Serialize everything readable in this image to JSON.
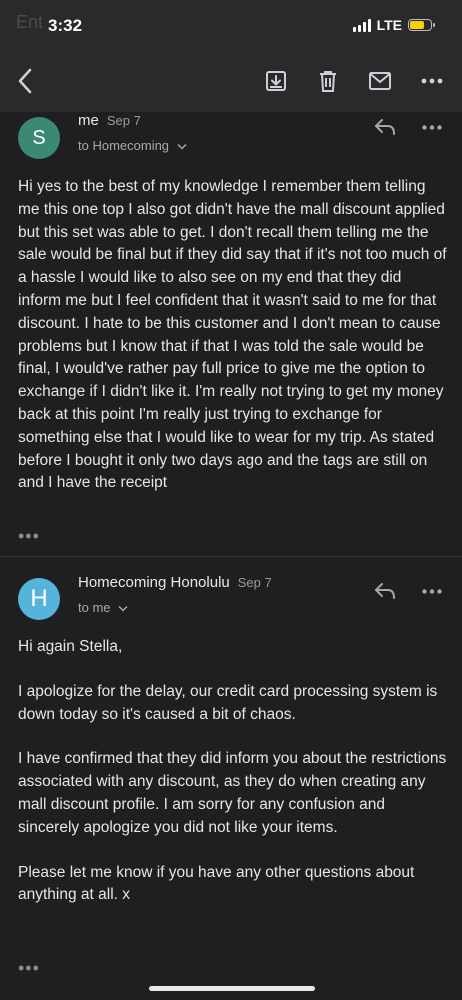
{
  "status_bar": {
    "time": "3:32",
    "network": "LTE",
    "ghost_text": "Ent"
  },
  "toolbar": {
    "icons": [
      "back-icon",
      "archive-icon",
      "trash-icon",
      "mail-icon",
      "more-icon"
    ]
  },
  "messages": [
    {
      "avatar_letter": "S",
      "avatar_color": "#3a8a73",
      "sender": "me",
      "date": "Sep 7",
      "to": "to Homecoming",
      "paragraphs": [
        "Hi yes to the best of my knowledge I remember them telling me this one top I also got didn't have the mall discount applied but this set was able to get. I don't recall them telling me the sale would be final but if they did say that if it's not too much of a hassle I would like to also see on my end that they did inform me but I feel confident that it wasn't said to me for that discount. I hate to be this customer and I don't mean to cause problems but I know that if that I was told the sale would be final, I would've rather pay full price to give me the option to exchange if I didn't like it. I'm really not trying to get my money back at this point I'm really just trying to exchange for something else that I would like to wear for my trip. As stated before I bought it only two days ago and the tags are still on and I have the receipt"
      ],
      "more": "•••"
    },
    {
      "avatar_letter": "H",
      "avatar_color": "#56b3d9",
      "sender": "Homecoming Honolulu",
      "date": "Sep 7",
      "to": "to me",
      "paragraphs": [
        "Hi again Stella,",
        "I apologize for the delay, our credit card processing system is down today so it's caused a bit of chaos.",
        "I have confirmed that they did inform you about the restrictions associated with any discount, as they do when creating any mall discount profile.  I am sorry for any confusion and sincerely apologize you did not like your items.",
        "Please let me know if you have any other questions about anything at all. x"
      ],
      "more": "•••"
    }
  ]
}
